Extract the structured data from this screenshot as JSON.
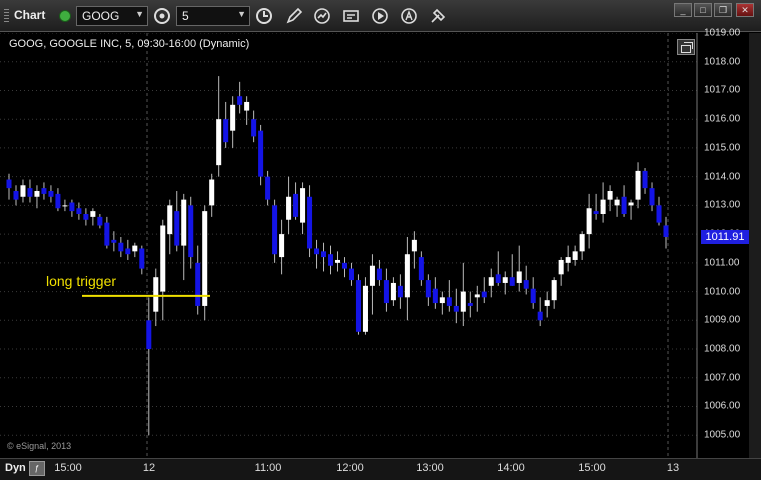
{
  "toolbar": {
    "title": "Chart",
    "symbol": "GOOG",
    "interval": "5"
  },
  "chart": {
    "title": "GOOG, GOOGLE INC, 5, 09:30-16:00 (Dynamic)",
    "copyright": "© eSignal, 2013",
    "annotation": "long trigger",
    "last_price_label": "1011.91",
    "mode_label": "Dyn"
  },
  "colors": {
    "up_candle": "#ffffff",
    "down_candle": "#1414e6",
    "annotation_line": "#f0e000",
    "background": "#000000",
    "grid": "#3a3a3a"
  },
  "chart_data": {
    "type": "candlestick",
    "y_range": [
      1004.6,
      1019.2
    ],
    "y_ticks": [
      "1019.00",
      "1018.00",
      "1017.00",
      "1016.00",
      "1015.00",
      "1014.00",
      "1013.00",
      "1012.00",
      "1011.00",
      "1010.00",
      "1009.00",
      "1008.00",
      "1007.00",
      "1006.00",
      "1005.00"
    ],
    "x_ticks": [
      "15:00",
      "12",
      "11:00",
      "12:00",
      "13:00",
      "14:00",
      "15:00",
      "13"
    ],
    "last_price": 1011.91,
    "long_trigger_level": 1009.85,
    "candles": [
      [
        1013.9,
        1014.1,
        1013.2,
        1013.6
      ],
      [
        1013.5,
        1013.7,
        1013.0,
        1013.2
      ],
      [
        1013.3,
        1013.9,
        1013.1,
        1013.7
      ],
      [
        1013.6,
        1013.9,
        1013.1,
        1013.3
      ],
      [
        1013.3,
        1013.7,
        1012.9,
        1013.5
      ],
      [
        1013.6,
        1013.8,
        1013.2,
        1013.4
      ],
      [
        1013.5,
        1013.7,
        1013.1,
        1013.3
      ],
      [
        1013.4,
        1013.6,
        1012.8,
        1012.9
      ],
      [
        1013.0,
        1013.2,
        1012.8,
        1013.0
      ],
      [
        1013.1,
        1013.2,
        1012.6,
        1012.8
      ],
      [
        1012.9,
        1013.1,
        1012.5,
        1012.7
      ],
      [
        1012.7,
        1012.9,
        1012.3,
        1012.5
      ],
      [
        1012.6,
        1012.9,
        1012.3,
        1012.8
      ],
      [
        1012.6,
        1012.7,
        1012.2,
        1012.3
      ],
      [
        1012.4,
        1012.6,
        1011.5,
        1011.6
      ],
      [
        1011.8,
        1012.1,
        1011.4,
        1011.7
      ],
      [
        1011.7,
        1011.9,
        1011.2,
        1011.4
      ],
      [
        1011.5,
        1011.8,
        1011.1,
        1011.3
      ],
      [
        1011.4,
        1011.7,
        1011.2,
        1011.6
      ],
      [
        1011.5,
        1011.6,
        1010.6,
        1010.8
      ],
      [
        1009.0,
        1009.8,
        1005.0,
        1008.0
      ],
      [
        1009.3,
        1010.8,
        1008.8,
        1010.5
      ],
      [
        1010.0,
        1012.5,
        1009.0,
        1012.3
      ],
      [
        1012.0,
        1013.2,
        1011.3,
        1013.0
      ],
      [
        1012.8,
        1013.5,
        1011.4,
        1011.6
      ],
      [
        1011.6,
        1013.4,
        1010.4,
        1013.2
      ],
      [
        1013.0,
        1013.3,
        1010.8,
        1011.2
      ],
      [
        1011.0,
        1011.6,
        1009.2,
        1009.5
      ],
      [
        1009.5,
        1013.0,
        1009.0,
        1012.8
      ],
      [
        1013.0,
        1014.1,
        1012.6,
        1013.9
      ],
      [
        1014.4,
        1017.5,
        1014.0,
        1016.0
      ],
      [
        1016.0,
        1016.6,
        1015.0,
        1015.2
      ],
      [
        1015.6,
        1016.8,
        1015.0,
        1016.5
      ],
      [
        1016.8,
        1017.3,
        1016.2,
        1016.5
      ],
      [
        1016.3,
        1016.8,
        1015.8,
        1016.6
      ],
      [
        1016.0,
        1016.3,
        1015.2,
        1015.4
      ],
      [
        1015.6,
        1015.8,
        1013.7,
        1014.0
      ],
      [
        1014.0,
        1014.2,
        1013.0,
        1013.2
      ],
      [
        1013.0,
        1013.2,
        1011.0,
        1011.3
      ],
      [
        1011.2,
        1012.5,
        1010.6,
        1012.0
      ],
      [
        1012.5,
        1014.0,
        1012.0,
        1013.3
      ],
      [
        1013.4,
        1013.8,
        1012.5,
        1012.6
      ],
      [
        1012.4,
        1013.8,
        1012.0,
        1013.6
      ],
      [
        1013.3,
        1013.7,
        1011.2,
        1011.5
      ],
      [
        1011.5,
        1011.8,
        1010.8,
        1011.3
      ],
      [
        1011.4,
        1011.7,
        1010.7,
        1011.2
      ],
      [
        1011.3,
        1011.6,
        1010.6,
        1010.9
      ],
      [
        1011.0,
        1011.4,
        1010.7,
        1011.1
      ],
      [
        1011.0,
        1011.2,
        1010.5,
        1010.8
      ],
      [
        1010.8,
        1011.0,
        1010.2,
        1010.4
      ],
      [
        1010.4,
        1010.6,
        1008.5,
        1008.6
      ],
      [
        1008.6,
        1010.5,
        1008.5,
        1010.2
      ],
      [
        1010.2,
        1011.3,
        1009.2,
        1010.9
      ],
      [
        1010.8,
        1011.1,
        1010.2,
        1010.4
      ],
      [
        1010.4,
        1010.8,
        1009.3,
        1009.6
      ],
      [
        1009.7,
        1010.5,
        1009.5,
        1010.3
      ],
      [
        1010.2,
        1010.6,
        1009.4,
        1009.8
      ],
      [
        1009.8,
        1011.9,
        1009.0,
        1011.3
      ],
      [
        1011.4,
        1012.1,
        1010.8,
        1011.8
      ],
      [
        1011.2,
        1011.4,
        1010.2,
        1010.4
      ],
      [
        1010.4,
        1010.6,
        1009.5,
        1009.8
      ],
      [
        1010.1,
        1010.5,
        1009.4,
        1009.6
      ],
      [
        1009.6,
        1010.0,
        1009.2,
        1009.8
      ],
      [
        1009.8,
        1010.4,
        1009.3,
        1009.5
      ],
      [
        1009.5,
        1010.1,
        1008.9,
        1009.3
      ],
      [
        1009.3,
        1011.0,
        1008.8,
        1010.0
      ],
      [
        1009.6,
        1010.0,
        1009.1,
        1009.5
      ],
      [
        1009.8,
        1010.2,
        1009.3,
        1009.9
      ],
      [
        1010.0,
        1010.5,
        1009.6,
        1009.8
      ],
      [
        1010.2,
        1010.8,
        1009.8,
        1010.5
      ],
      [
        1010.6,
        1011.4,
        1010.2,
        1010.3
      ],
      [
        1010.3,
        1010.7,
        1009.9,
        1010.5
      ],
      [
        1010.5,
        1011.3,
        1010.2,
        1010.2
      ],
      [
        1010.3,
        1011.6,
        1010.0,
        1010.7
      ],
      [
        1010.4,
        1010.9,
        1009.9,
        1010.1
      ],
      [
        1010.1,
        1010.5,
        1009.4,
        1009.6
      ],
      [
        1009.3,
        1009.8,
        1008.8,
        1009.0
      ],
      [
        1009.5,
        1010.0,
        1009.1,
        1009.7
      ],
      [
        1009.7,
        1010.5,
        1009.4,
        1010.4
      ],
      [
        1010.6,
        1011.2,
        1010.2,
        1011.1
      ],
      [
        1011.0,
        1011.6,
        1010.7,
        1011.2
      ],
      [
        1011.1,
        1011.6,
        1010.9,
        1011.4
      ],
      [
        1011.4,
        1012.1,
        1011.1,
        1012.0
      ],
      [
        1012.0,
        1013.4,
        1011.5,
        1012.9
      ],
      [
        1012.8,
        1013.4,
        1012.5,
        1012.7
      ],
      [
        1012.7,
        1013.8,
        1012.4,
        1013.2
      ],
      [
        1013.2,
        1013.7,
        1012.8,
        1013.5
      ],
      [
        1013.0,
        1013.3,
        1012.6,
        1013.2
      ],
      [
        1013.3,
        1013.7,
        1012.6,
        1012.7
      ],
      [
        1013.0,
        1013.2,
        1012.5,
        1013.1
      ],
      [
        1013.2,
        1014.5,
        1012.9,
        1014.2
      ],
      [
        1014.2,
        1014.3,
        1013.4,
        1013.6
      ],
      [
        1013.6,
        1013.8,
        1012.8,
        1013.0
      ],
      [
        1013.0,
        1013.3,
        1012.3,
        1012.4
      ],
      [
        1012.3,
        1012.6,
        1011.5,
        1011.9
      ]
    ]
  }
}
